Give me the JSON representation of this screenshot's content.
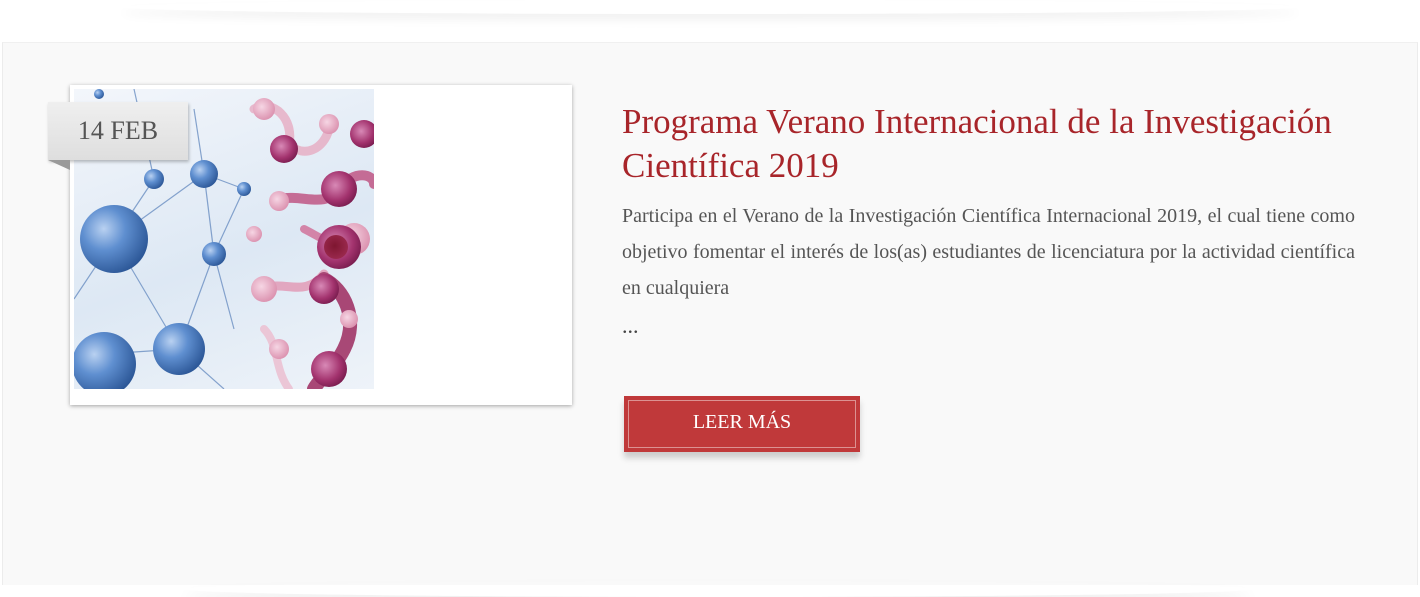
{
  "post": {
    "date": "14 FEB",
    "title": "Programa Verano Internacional de la Investigación Científica 2019",
    "excerpt": "Participa en el Verano de la Investigación Científica Internacional 2019, el cual tiene como objetivo fomentar el interés de los(as) estudiantes de licenciatura por la actividad científica en cualquiera",
    "ellipsis": "...",
    "read_more_label": "LEER MÁS",
    "image_icon": "molecule-network-image"
  },
  "colors": {
    "title": "#a8252a",
    "button": "#c0393a",
    "text": "#555555",
    "panel": "#f9f9f9"
  }
}
